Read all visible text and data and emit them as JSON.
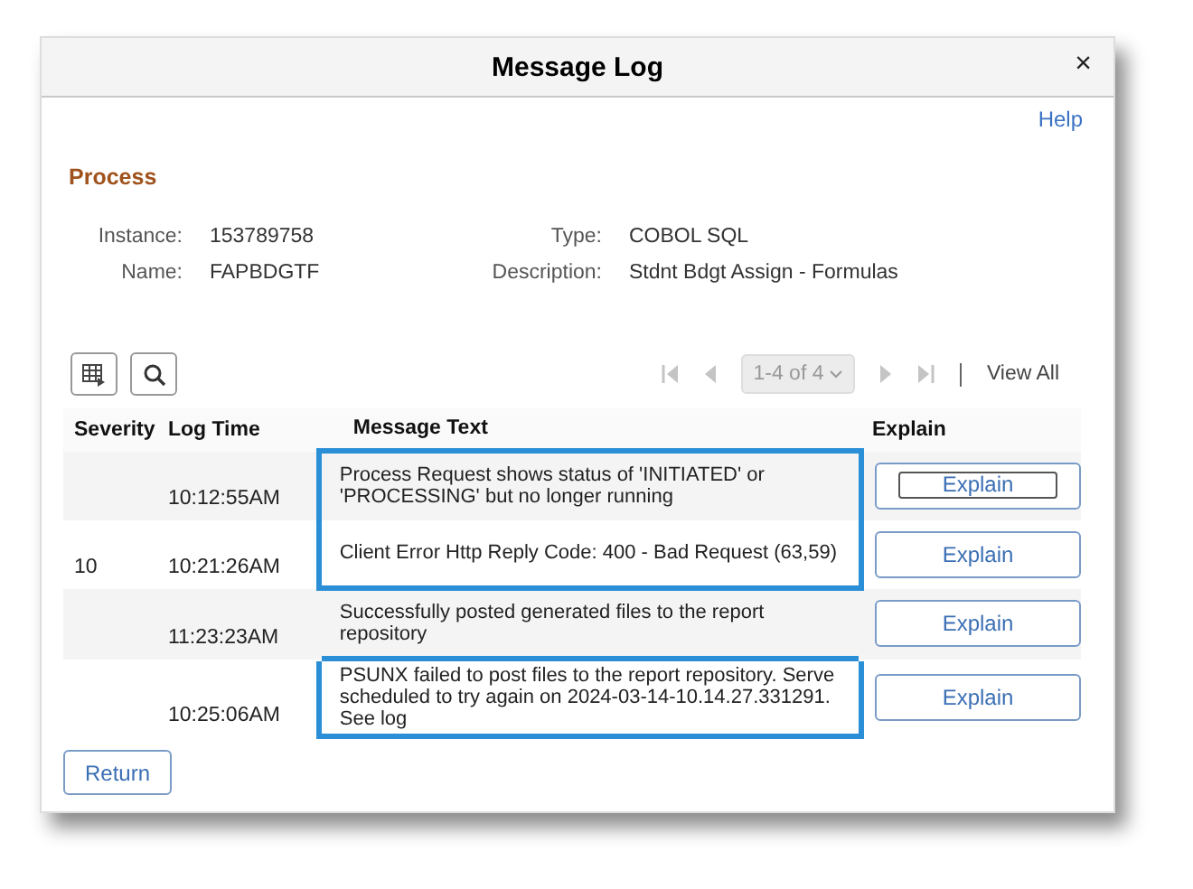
{
  "window": {
    "title": "Message Log",
    "close": "×"
  },
  "help": "Help",
  "section": "Process",
  "fields": [
    {
      "label": "Instance:",
      "value": "153789758"
    },
    {
      "label": "Type:",
      "value": "COBOL SQL"
    },
    {
      "label": "Name:",
      "value": "FAPBDGTF"
    },
    {
      "label": "Description:",
      "value": "Stdnt Bdgt Assign - Formulas"
    }
  ],
  "pager": {
    "range": "1-4 of 4",
    "view_all": "View All"
  },
  "table": {
    "columns": [
      "Severity",
      "Log Time",
      "Message Text",
      "Explain"
    ],
    "rows": [
      {
        "severity": "",
        "time": "10:12:55AM",
        "message": "Process Request shows status of 'INITIATED' or 'PROCESSING' but no longer running",
        "button": "Explain",
        "focused": true,
        "highlighted": true
      },
      {
        "severity": "10",
        "time": "10:21:26AM",
        "message": "Client Error Http Reply Code: 400 - Bad Request (63,59)",
        "button": "Explain",
        "focused": false,
        "highlighted": true
      },
      {
        "severity": "",
        "time": "11:23:23AM",
        "message": "Successfully posted generated files to the report repository",
        "button": "Explain",
        "focused": false,
        "highlighted": false
      },
      {
        "severity": "",
        "time": "10:25:06AM",
        "message": "PSUNX failed to post files to the report repository.  Serve scheduled to try again on 2024-03-14-10.14.27.331291. See log",
        "button": "Explain",
        "focused": false,
        "highlighted": true
      }
    ]
  },
  "return_button": "Return"
}
